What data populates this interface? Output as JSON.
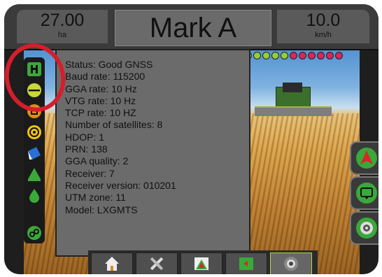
{
  "header": {
    "area_value": "27.00",
    "area_unit": "ha",
    "title": "Mark A",
    "speed_value": "10.0",
    "speed_unit": "km/h"
  },
  "info_panel": {
    "lines": [
      "Status: Good GNSS",
      "Baud rate: 115200",
      "GGA rate: 10 Hz",
      "VTG rate: 10 Hz",
      "TCP rate: 10 HZ",
      "Number of satellites: 8",
      "HDOP: 1",
      "PRN: 138",
      "GGA quality: 2",
      "Receiver: 7",
      "Receiver version: 010201",
      "UTM zone: 11",
      "Model: LXGMTS"
    ]
  },
  "sidebar_icons": [
    "gps-status-icon",
    "guidance-line-icon",
    "boundary-icon",
    "steering-icon",
    "tilt-icon",
    "section-control-icon",
    "rate-control-icon",
    "link-icon"
  ],
  "led_bar": {
    "colors": [
      "#9acd32",
      "#9acd32",
      "#9acd32",
      "#9acd32",
      "#9acd32",
      "#9acd32",
      "#d6285a",
      "#d6285a",
      "#d6285a",
      "#d6285a",
      "#d6285a",
      "#d6285a"
    ]
  },
  "right_buttons": [
    "vehicle-view-icon",
    "screen-mode-icon",
    "camera-icon"
  ],
  "bottom_buttons": [
    "home-icon",
    "tools-icon",
    "guidance-screen-icon",
    "mapping-icon",
    "camera-view-icon"
  ],
  "colors": {
    "annotation_circle": "#d51e2c",
    "accent": "#b5d34a",
    "status_green": "#3aa83a"
  }
}
